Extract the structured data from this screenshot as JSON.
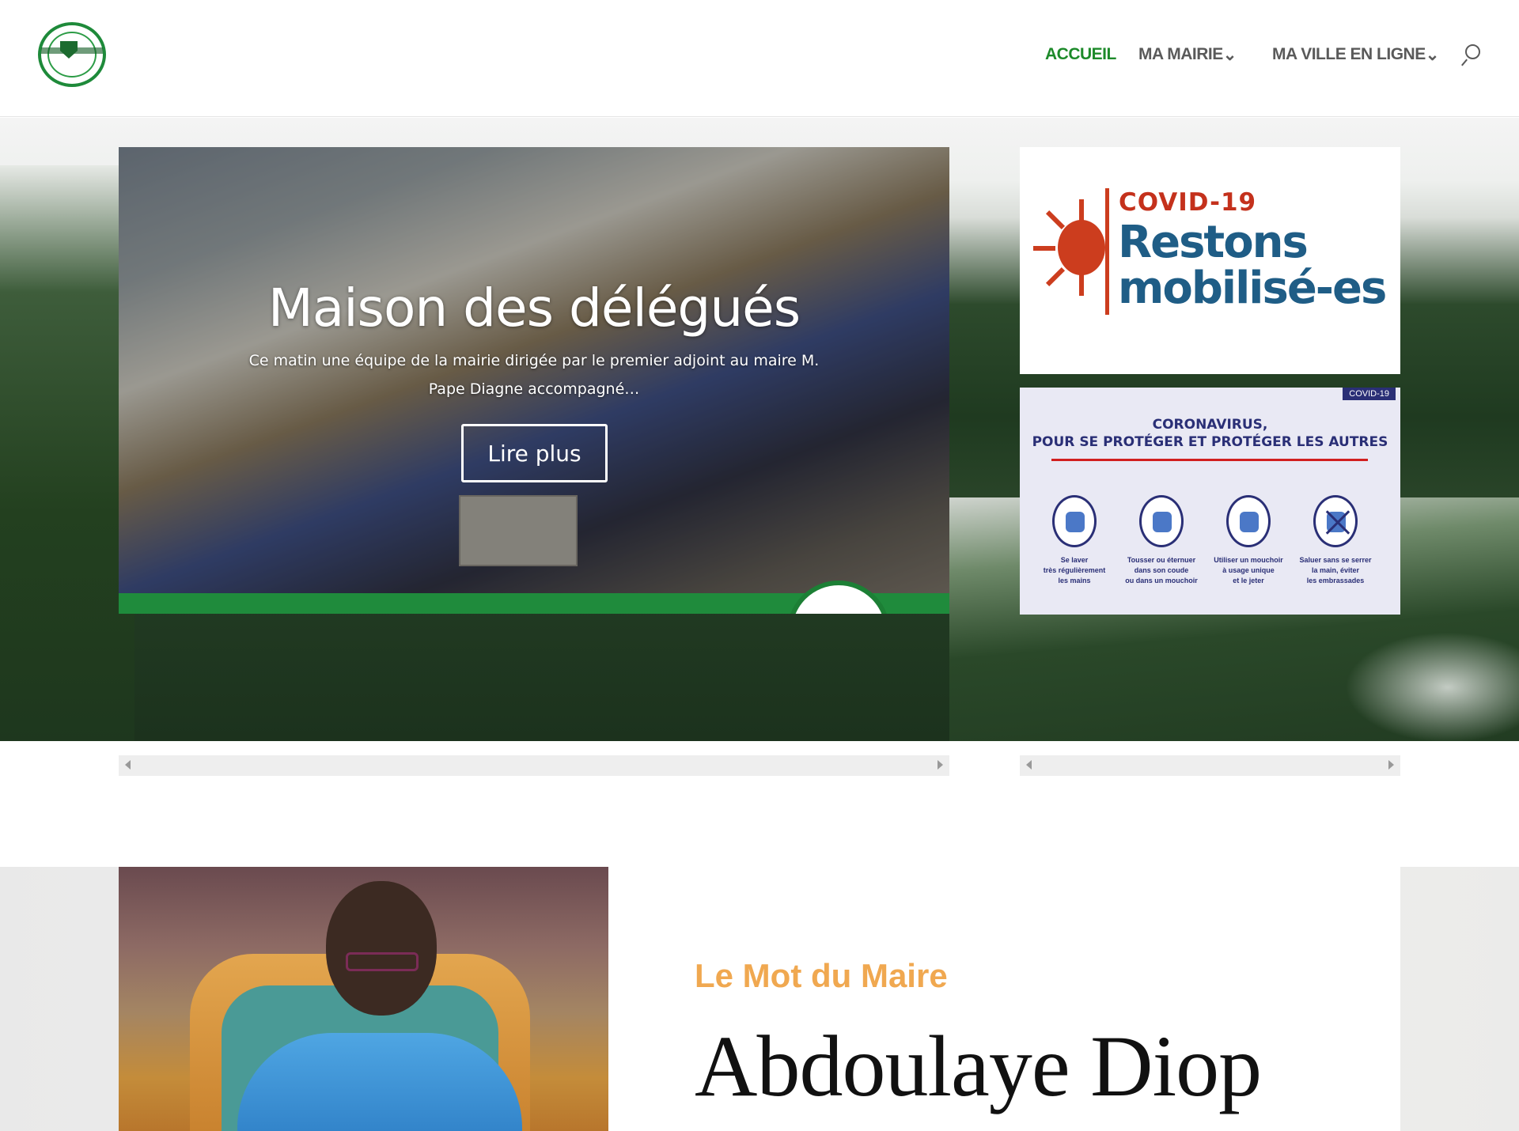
{
  "header": {
    "nav": [
      {
        "label": "ACCUEIL",
        "active": true
      },
      {
        "label": "MA MAIRIE",
        "has_dropdown": true
      },
      {
        "label": "MA VILLE EN LIGNE",
        "has_dropdown": true
      }
    ],
    "search_icon": "search-icon",
    "accent_color": "#1d8a2a"
  },
  "slider_main": {
    "title": "Maison des délégués",
    "excerpt": "Ce matin une équipe de la mairie dirigée par le premier adjoint au maire M. Pape Diagne accompagné…",
    "button_label": "Lire plus"
  },
  "slider_side": {
    "covid_card": {
      "heading": "COVID-19",
      "line1": "Restons",
      "line2": "mobilisé-es"
    },
    "gestures_card": {
      "tag": "COVID-19",
      "title_line1": "CORONAVIRUS,",
      "title_line2": "POUR SE PROTÉGER ET PROTÉGER LES AUTRES",
      "gestures": [
        {
          "label": "Se laver\ntrès régulièrement\nles mains"
        },
        {
          "label": "Tousser ou éternuer\ndans son coude\nou dans un mouchoir"
        },
        {
          "label": "Utiliser un mouchoir\nà usage unique\net le jeter"
        },
        {
          "label": "Saluer sans se serrer\nla main, éviter\nles embrassades"
        }
      ]
    }
  },
  "mayor": {
    "section_label": "Le Mot du Maire",
    "name": "Abdoulaye Diop"
  }
}
